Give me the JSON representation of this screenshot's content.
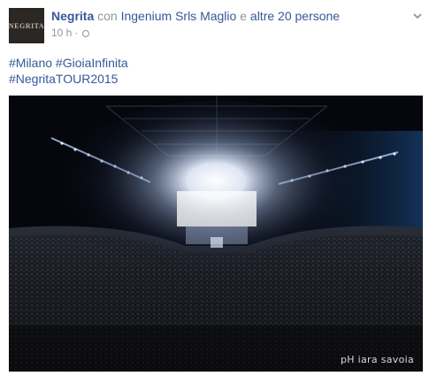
{
  "post": {
    "avatar_text": "NEGRITA",
    "author": "Negrita",
    "with_prefix": "con",
    "tagged_person": "Ingenium Srls Maglio",
    "conjunction": "e",
    "others": "altre 20 persone",
    "time": "10 h",
    "separator": "·",
    "privacy_icon": "globe-icon",
    "menu_icon": "chevron-down-icon",
    "hashtags_line1": [
      "#Milano",
      "#GioiaInfinita"
    ],
    "hashtags_line2": [
      "#NegritaTOUR2015"
    ],
    "photo": {
      "description_icon": "concert-arena-photo",
      "credit": "pH iara savoia"
    }
  }
}
